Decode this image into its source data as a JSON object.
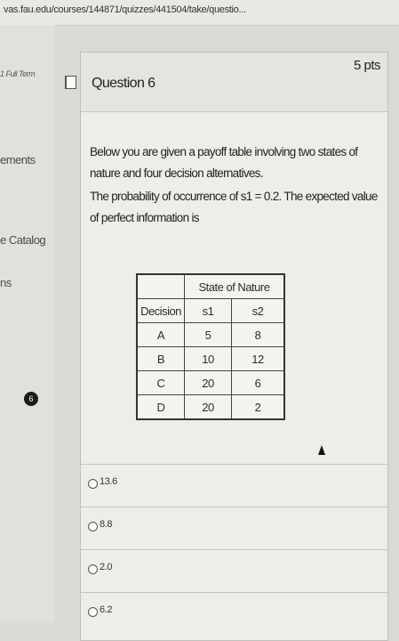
{
  "browser": {
    "url": "vas.fau.edu/courses/144871/quizzes/441504/take/questio..."
  },
  "nav": {
    "term": "1 Full Term",
    "items": [
      {
        "label": "ements"
      },
      {
        "label": "e Catalog"
      },
      {
        "label": "ns"
      }
    ],
    "badge": "6"
  },
  "question": {
    "title": "Question 6",
    "points": "5 pts",
    "text": [
      "Below you are given a payoff table involving two states of nature and four decision alternatives.",
      "The probability of occurrence of s1 = 0.2. The expected value of perfect information is"
    ],
    "table": {
      "group_header": "State of Nature",
      "columns": [
        "Decision",
        "s1",
        "s2"
      ],
      "rows": [
        [
          "A",
          "5",
          "8"
        ],
        [
          "B",
          "10",
          "12"
        ],
        [
          "C",
          "20",
          "6"
        ],
        [
          "D",
          "20",
          "2"
        ]
      ]
    },
    "answers": [
      "13.6",
      "8.8",
      "2.0",
      "6.2"
    ]
  }
}
